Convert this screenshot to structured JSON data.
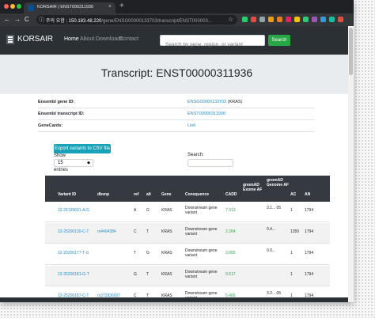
{
  "browser": {
    "tab_title": "KORSAIR | ENST000311936",
    "tab_close": "×",
    "new_tab": "+",
    "url_secure_label": "주의 요함",
    "url_host": "150.183.48.220",
    "url_path": "/gene/ENSG00000133703/transcript/ENST000003...",
    "back": "←",
    "forward": "→",
    "reload": "C",
    "info_icon": "ⓘ",
    "star": "☆",
    "extension_colors": [
      "#2ecc71",
      "#e74c3c",
      "#95a5a6",
      "#f39c12",
      "#e67e22",
      "#e91e63",
      "#f1c40f",
      "#2ecc71",
      "#9b59b6",
      "#3498db",
      "#1abc9c",
      "#e74c3c"
    ]
  },
  "navbar": {
    "brand": "KORSAIR",
    "links": [
      "Home",
      "About",
      "Downloads",
      "Contact"
    ],
    "search_placeholder": "Search by gene, region, or variant",
    "search_button": "Search"
  },
  "hero": {
    "title": "Transcript: ENST00000311936"
  },
  "info": {
    "rows": [
      {
        "label": "Ensembl gene ID:",
        "link": "ENSG00000133703",
        "suffix": " (KRAS)"
      },
      {
        "label": "Ensembl transcript ID:",
        "link": "ENST00000311936",
        "suffix": ""
      },
      {
        "label": "GeneCards:",
        "link": "Link",
        "suffix": ""
      }
    ]
  },
  "controls": {
    "export_label": "Export variants to CSV file",
    "show_label": "Show",
    "show_value": "15",
    "show_caret": "◆",
    "entries_label": "entries",
    "search_label": "Search:"
  },
  "table": {
    "headers": [
      "Variant ID",
      "dbsnp",
      "ref",
      "alt",
      "Gene",
      "Consquence",
      "CADD",
      "gnomAD Exome AF",
      "gnomAD Genome AF",
      "AC",
      "AN"
    ],
    "rows": [
      [
        "12-25199601-A-G",
        "",
        "A",
        "G",
        "KRAS",
        "Downstream gene variant",
        "7.913",
        "",
        "3.1... 05",
        "1",
        "1794"
      ],
      [
        "12-25200130-C-T",
        "rs4404384",
        "C",
        "T",
        "KRAS",
        "Downstream gene variant",
        "2.264",
        "",
        "0.4...",
        "1355",
        "1794"
      ],
      [
        "12-25200177-T-G",
        "",
        "T",
        "G",
        "KRAS",
        "Downstream gene variant",
        "3.055",
        "",
        "0.0...",
        "1",
        "1794"
      ],
      [
        "12-25200181-G-T",
        "",
        "G",
        "T",
        "KRAS",
        "Downstream gene variant",
        "0.617",
        "",
        "",
        "1",
        "1794"
      ],
      [
        "12-25200187-C-T",
        "rs372836027",
        "C",
        "T",
        "KRAS",
        "Downstream gene variant",
        "5.465",
        "",
        "3.2... 05",
        "1",
        "1794"
      ],
      [
        "12-25200...",
        "",
        "GGA",
        "G",
        "KRAS",
        "Downstream gene",
        "1.056",
        "",
        "",
        "1",
        "1794"
      ]
    ]
  }
}
